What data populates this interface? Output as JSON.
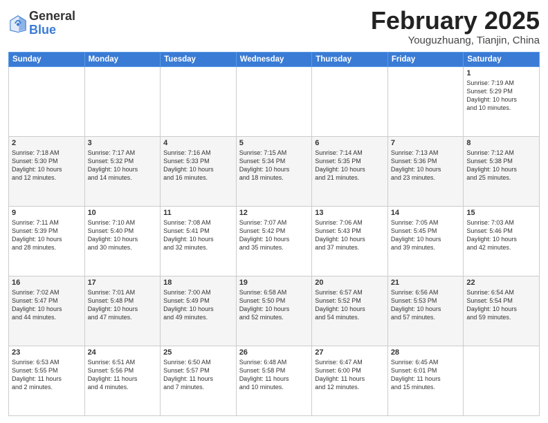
{
  "logo": {
    "general": "General",
    "blue": "Blue"
  },
  "header": {
    "month": "February 2025",
    "location": "Youguzhuang, Tianjin, China"
  },
  "weekdays": [
    "Sunday",
    "Monday",
    "Tuesday",
    "Wednesday",
    "Thursday",
    "Friday",
    "Saturday"
  ],
  "weeks": [
    [
      {
        "day": "",
        "info": ""
      },
      {
        "day": "",
        "info": ""
      },
      {
        "day": "",
        "info": ""
      },
      {
        "day": "",
        "info": ""
      },
      {
        "day": "",
        "info": ""
      },
      {
        "day": "",
        "info": ""
      },
      {
        "day": "1",
        "info": "Sunrise: 7:19 AM\nSunset: 5:29 PM\nDaylight: 10 hours\nand 10 minutes."
      }
    ],
    [
      {
        "day": "2",
        "info": "Sunrise: 7:18 AM\nSunset: 5:30 PM\nDaylight: 10 hours\nand 12 minutes."
      },
      {
        "day": "3",
        "info": "Sunrise: 7:17 AM\nSunset: 5:32 PM\nDaylight: 10 hours\nand 14 minutes."
      },
      {
        "day": "4",
        "info": "Sunrise: 7:16 AM\nSunset: 5:33 PM\nDaylight: 10 hours\nand 16 minutes."
      },
      {
        "day": "5",
        "info": "Sunrise: 7:15 AM\nSunset: 5:34 PM\nDaylight: 10 hours\nand 18 minutes."
      },
      {
        "day": "6",
        "info": "Sunrise: 7:14 AM\nSunset: 5:35 PM\nDaylight: 10 hours\nand 21 minutes."
      },
      {
        "day": "7",
        "info": "Sunrise: 7:13 AM\nSunset: 5:36 PM\nDaylight: 10 hours\nand 23 minutes."
      },
      {
        "day": "8",
        "info": "Sunrise: 7:12 AM\nSunset: 5:38 PM\nDaylight: 10 hours\nand 25 minutes."
      }
    ],
    [
      {
        "day": "9",
        "info": "Sunrise: 7:11 AM\nSunset: 5:39 PM\nDaylight: 10 hours\nand 28 minutes."
      },
      {
        "day": "10",
        "info": "Sunrise: 7:10 AM\nSunset: 5:40 PM\nDaylight: 10 hours\nand 30 minutes."
      },
      {
        "day": "11",
        "info": "Sunrise: 7:08 AM\nSunset: 5:41 PM\nDaylight: 10 hours\nand 32 minutes."
      },
      {
        "day": "12",
        "info": "Sunrise: 7:07 AM\nSunset: 5:42 PM\nDaylight: 10 hours\nand 35 minutes."
      },
      {
        "day": "13",
        "info": "Sunrise: 7:06 AM\nSunset: 5:43 PM\nDaylight: 10 hours\nand 37 minutes."
      },
      {
        "day": "14",
        "info": "Sunrise: 7:05 AM\nSunset: 5:45 PM\nDaylight: 10 hours\nand 39 minutes."
      },
      {
        "day": "15",
        "info": "Sunrise: 7:03 AM\nSunset: 5:46 PM\nDaylight: 10 hours\nand 42 minutes."
      }
    ],
    [
      {
        "day": "16",
        "info": "Sunrise: 7:02 AM\nSunset: 5:47 PM\nDaylight: 10 hours\nand 44 minutes."
      },
      {
        "day": "17",
        "info": "Sunrise: 7:01 AM\nSunset: 5:48 PM\nDaylight: 10 hours\nand 47 minutes."
      },
      {
        "day": "18",
        "info": "Sunrise: 7:00 AM\nSunset: 5:49 PM\nDaylight: 10 hours\nand 49 minutes."
      },
      {
        "day": "19",
        "info": "Sunrise: 6:58 AM\nSunset: 5:50 PM\nDaylight: 10 hours\nand 52 minutes."
      },
      {
        "day": "20",
        "info": "Sunrise: 6:57 AM\nSunset: 5:52 PM\nDaylight: 10 hours\nand 54 minutes."
      },
      {
        "day": "21",
        "info": "Sunrise: 6:56 AM\nSunset: 5:53 PM\nDaylight: 10 hours\nand 57 minutes."
      },
      {
        "day": "22",
        "info": "Sunrise: 6:54 AM\nSunset: 5:54 PM\nDaylight: 10 hours\nand 59 minutes."
      }
    ],
    [
      {
        "day": "23",
        "info": "Sunrise: 6:53 AM\nSunset: 5:55 PM\nDaylight: 11 hours\nand 2 minutes."
      },
      {
        "day": "24",
        "info": "Sunrise: 6:51 AM\nSunset: 5:56 PM\nDaylight: 11 hours\nand 4 minutes."
      },
      {
        "day": "25",
        "info": "Sunrise: 6:50 AM\nSunset: 5:57 PM\nDaylight: 11 hours\nand 7 minutes."
      },
      {
        "day": "26",
        "info": "Sunrise: 6:48 AM\nSunset: 5:58 PM\nDaylight: 11 hours\nand 10 minutes."
      },
      {
        "day": "27",
        "info": "Sunrise: 6:47 AM\nSunset: 6:00 PM\nDaylight: 11 hours\nand 12 minutes."
      },
      {
        "day": "28",
        "info": "Sunrise: 6:45 AM\nSunset: 6:01 PM\nDaylight: 11 hours\nand 15 minutes."
      },
      {
        "day": "",
        "info": ""
      }
    ]
  ]
}
